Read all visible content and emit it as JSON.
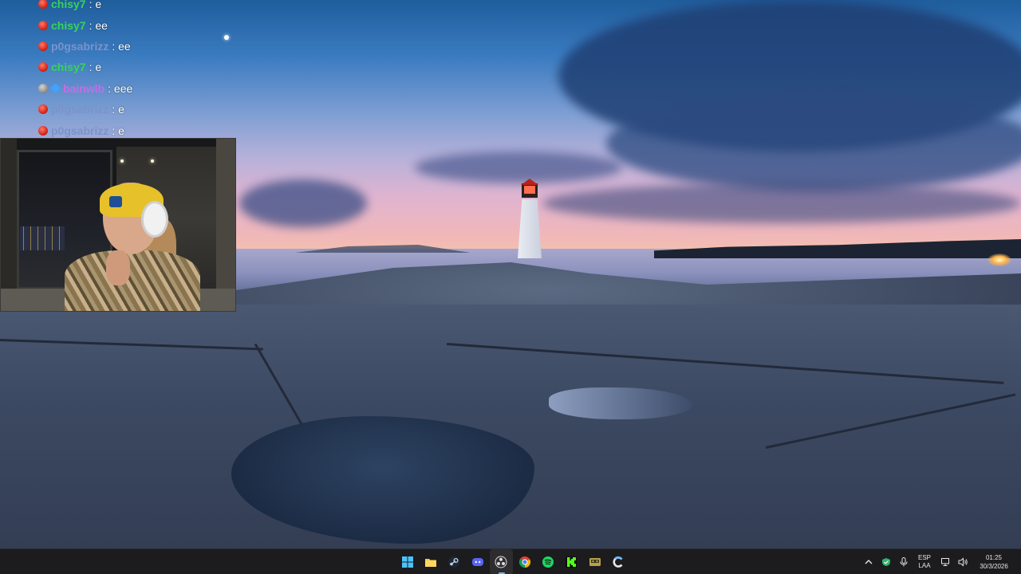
{
  "chat": {
    "messages": [
      {
        "user": "chisy7",
        "text": "e",
        "user_color": "#36d45a",
        "badge": "red-badge"
      },
      {
        "user": "chisy7",
        "text": "ee",
        "user_color": "#36d45a",
        "badge": "red-badge"
      },
      {
        "user": "p0gsabrizz",
        "text": "ee",
        "user_color": "#7b93ca",
        "badge": "red-badge"
      },
      {
        "user": "chisy7",
        "text": "e",
        "user_color": "#36d45a",
        "badge": "red-badge"
      },
      {
        "user": "bainwlb",
        "text": "eee",
        "user_color": "#c86be6",
        "badge": "grey-badge"
      },
      {
        "user": "p0gsabrizz",
        "text": "e",
        "user_color": "#7b93ca",
        "badge": "red-badge"
      },
      {
        "user": "p0gsabrizz",
        "text": "e",
        "user_color": "#7b93ca",
        "badge": "red-badge"
      }
    ],
    "separator": ":"
  },
  "taskbar": {
    "apps": [
      {
        "name": "start",
        "icon": "windows-start-icon"
      },
      {
        "name": "file-explorer",
        "icon": "folder-icon"
      },
      {
        "name": "steam",
        "icon": "steam-icon"
      },
      {
        "name": "discord",
        "icon": "discord-icon"
      },
      {
        "name": "obs",
        "icon": "obs-icon",
        "active": true
      },
      {
        "name": "chrome",
        "icon": "chrome-icon"
      },
      {
        "name": "spotify",
        "icon": "spotify-icon"
      },
      {
        "name": "kick",
        "icon": "kick-icon"
      },
      {
        "name": "app-8",
        "icon": "cassette-icon"
      },
      {
        "name": "app-9",
        "icon": "c-logo-icon"
      }
    ],
    "tray": {
      "language_top": "ESP",
      "language_bottom": "LAA",
      "time": "01:25",
      "date": "30/3/2026"
    }
  },
  "colors": {
    "taskbar_bg": "#1c1c1e",
    "accent": "#6cb8ff"
  }
}
